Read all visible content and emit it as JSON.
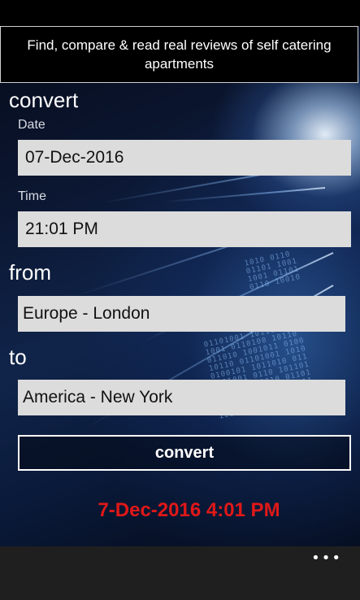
{
  "banner": {
    "text": "Find, compare & read real reviews of self catering apartments"
  },
  "title": "convert",
  "date": {
    "label": "Date",
    "value": "07-Dec-2016"
  },
  "time": {
    "label": "Time",
    "value": "21:01 PM"
  },
  "from": {
    "label": "from",
    "value": "Europe - London"
  },
  "to": {
    "label": "to",
    "value": "America - New York"
  },
  "convert_button": "convert",
  "result": "7-Dec-2016 4:01 PM",
  "app_bar": {
    "more_icon": "ellipsis-icon",
    "more_label": "•••"
  },
  "colors": {
    "result": "#e01818",
    "field_bg": "#dcdcdc",
    "background": "#0b1630"
  }
}
